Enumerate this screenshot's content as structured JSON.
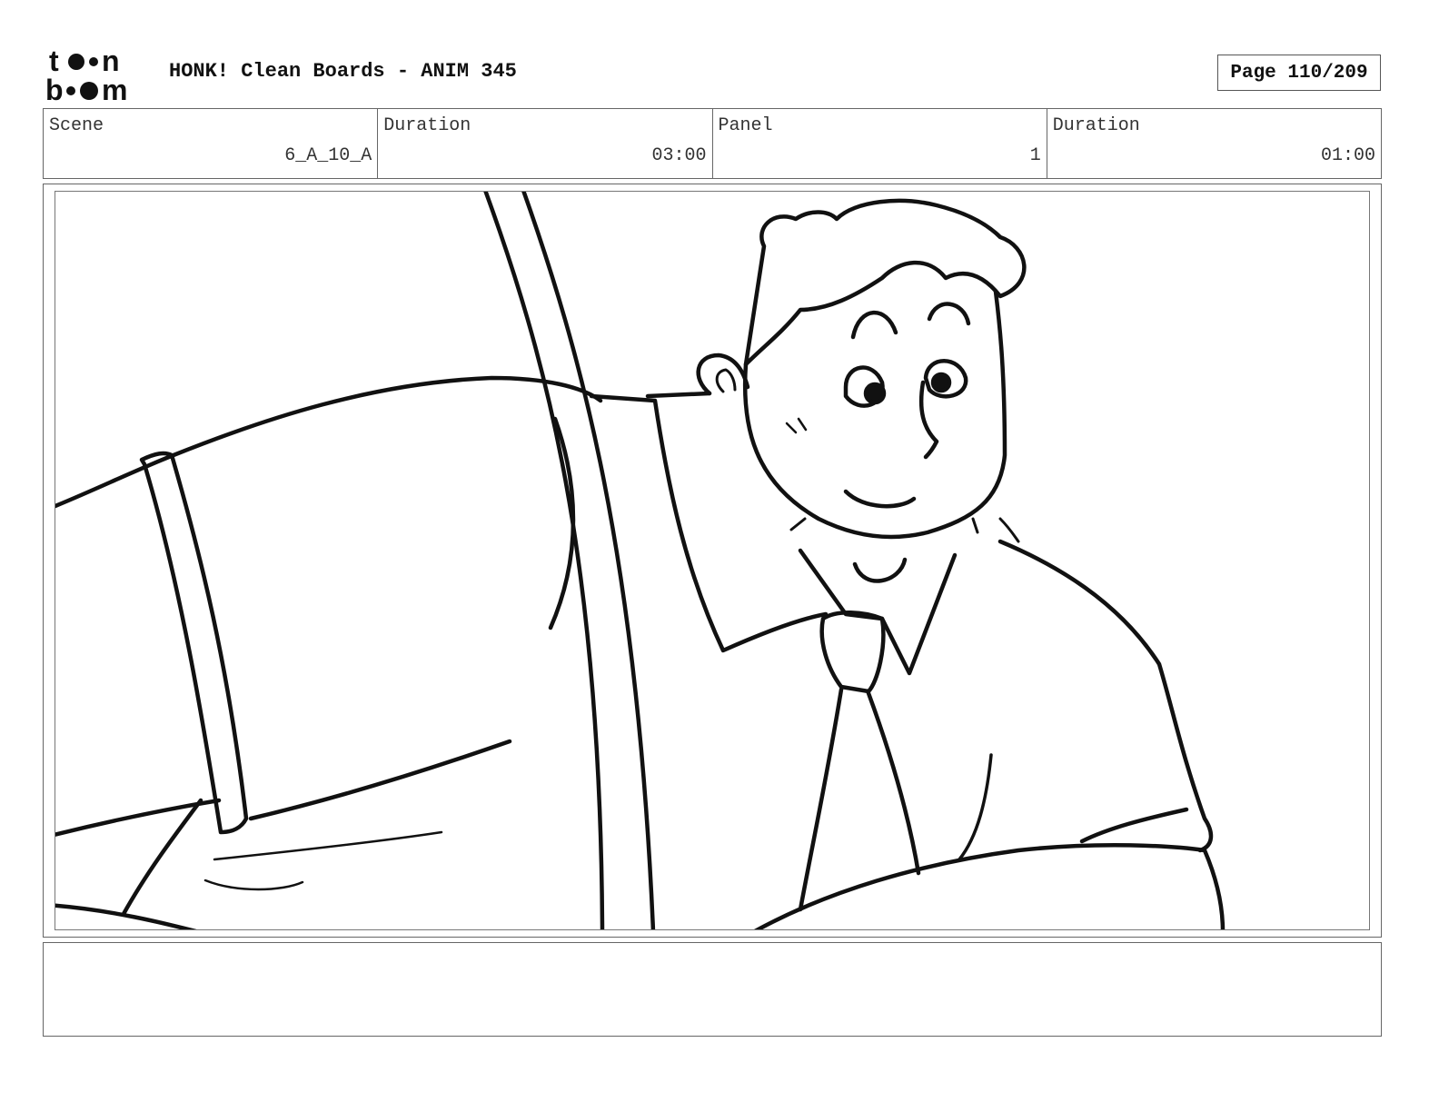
{
  "header": {
    "logo_text": "toon boom",
    "title": "HONK! Clean Boards - ANIM 345",
    "page_label": "Page 110/209"
  },
  "info": {
    "scene_label": "Scene",
    "scene_value": "6_A_10_A",
    "scene_duration_label": "Duration",
    "scene_duration_value": "03:00",
    "panel_label": "Panel",
    "panel_value": "1",
    "panel_duration_label": "Duration",
    "panel_duration_value": "01:00"
  },
  "notes": {
    "text": ""
  }
}
